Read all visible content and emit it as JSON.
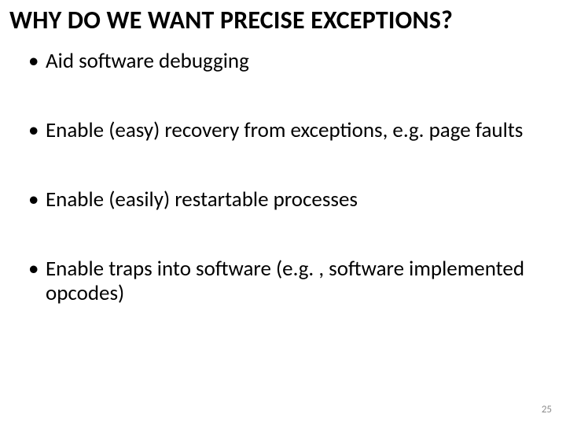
{
  "title": "WHY DO WE WANT PRECISE EXCEPTIONS?",
  "bullets": [
    "Aid software debugging",
    "Enable (easy) recovery from exceptions, e.g. page faults",
    "Enable (easily) restartable processes",
    "Enable traps into software (e.g. , software implemented opcodes)"
  ],
  "page_number": "25"
}
